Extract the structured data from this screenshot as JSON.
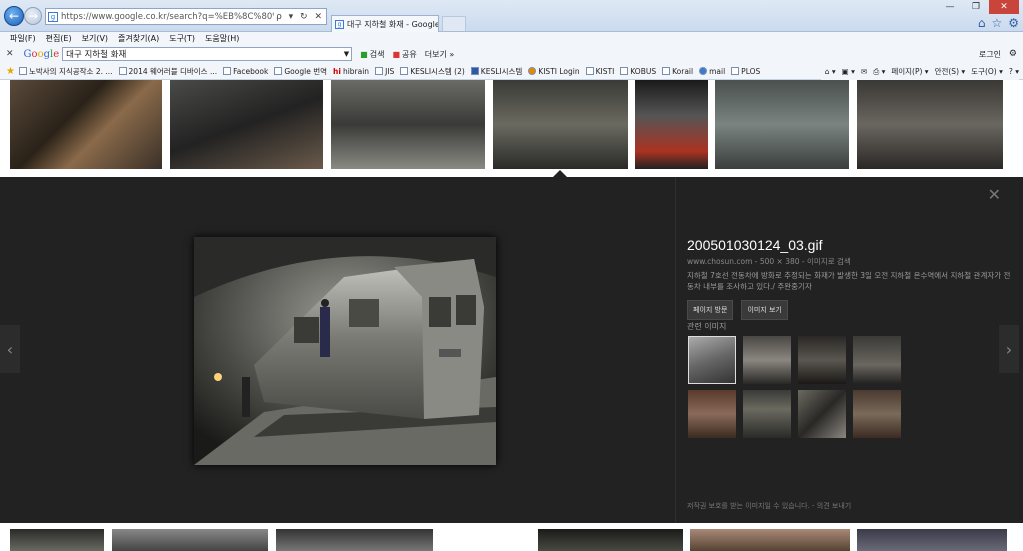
{
  "browser": {
    "url": "https://www.google.co.kr/search?q=%EB%8C%80%EA%B5%AC+%EC%A7",
    "address_tools": "ρ ▾ ↻ ✕",
    "tab_title": "대구 지하철 화재 - Google...",
    "tab_close": "✕",
    "win_min": "—",
    "win_max": "❐",
    "win_close": "✕",
    "icon_home": "⌂",
    "icon_fav": "☆",
    "icon_tools": "⚙"
  },
  "menu": [
    "파일(F)",
    "편집(E)",
    "보기(V)",
    "즐겨찾기(A)",
    "도구(T)",
    "도움말(H)"
  ],
  "google_toolbar": {
    "close": "✕",
    "logo": "Google",
    "query": "대구 지하철 화재",
    "search_label": "검색",
    "share_label": "공유",
    "more_label": "더보기 »",
    "login_label": "로그인",
    "wrench": "⚙"
  },
  "favorites": [
    "노박사의 지식공작소 2. ...",
    "2014 웨어러블 디바이스 ...",
    "Facebook",
    "Google 번역",
    "hibrain",
    "JIS",
    "KESLI시스템 (2)",
    "KESLI시스템",
    "KISTI Login",
    "KISTI",
    "KOBUS",
    "Korail",
    "mail",
    "PLOS"
  ],
  "command_bar": [
    "페이지(P) ▾",
    "안전(S) ▾",
    "도구(O) ▾",
    "? ▾"
  ],
  "detail": {
    "close": "✕",
    "prev": "‹",
    "next": "›",
    "title": "200501030124_03.gif",
    "meta": "www.chosun.com - 500 × 380 - 이미지로 검색",
    "description": "지하철 7호선 전동차에 방화로 추정되는 화재가 발생한 3일 오전 지하철 온수역에서 지하철 관계자가 전동차 내부를 조사하고 있다./ 주완중기자",
    "visit_page": "페이지 방문",
    "view_image": "이미지 보기",
    "related_label": "관련 이미지",
    "footer_note": "저작권 보호를 받는 이미지일 수 있습니다. - 의견 보내기"
  },
  "colors": {
    "panel_bg": "#222222",
    "chrome_bg": "#f2f5fa",
    "accent": "#1c5fb8"
  }
}
